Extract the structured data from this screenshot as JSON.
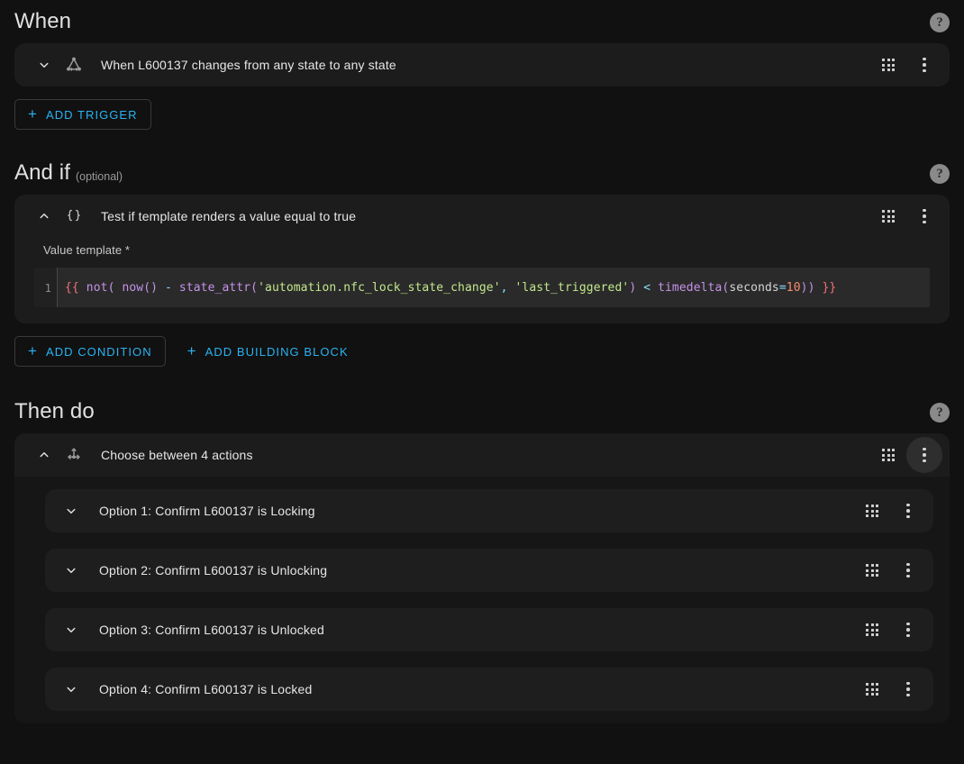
{
  "sections": {
    "when": {
      "title": "When",
      "help_label": "?",
      "trigger": {
        "title": "When L600137 changes from any state to any state",
        "icon": "state-trigger-icon"
      },
      "add_button": "ADD TRIGGER"
    },
    "and_if": {
      "title": "And if",
      "optional": "(optional)",
      "help_label": "?",
      "condition": {
        "title": "Test if template renders a value equal to true",
        "icon": "code-braces-icon",
        "field_label": "Value template *",
        "line_number": "1",
        "template": "{{ not( now() - state_attr('automation.nfc_lock_state_change', 'last_triggered') < timedelta(seconds=10)) }}",
        "template_tokens": [
          {
            "t": "{{",
            "c": "t-brace"
          },
          {
            "t": " ",
            "c": "t-plain"
          },
          {
            "t": "not(",
            "c": "t-fn"
          },
          {
            "t": " ",
            "c": "t-plain"
          },
          {
            "t": "now()",
            "c": "t-fn"
          },
          {
            "t": " ",
            "c": "t-plain"
          },
          {
            "t": "-",
            "c": "t-op"
          },
          {
            "t": " ",
            "c": "t-plain"
          },
          {
            "t": "state_attr(",
            "c": "t-fn"
          },
          {
            "t": "'automation.nfc_lock_state_change'",
            "c": "t-str"
          },
          {
            "t": ",",
            "c": "t-punc"
          },
          {
            "t": " ",
            "c": "t-plain"
          },
          {
            "t": "'last_triggered'",
            "c": "t-str"
          },
          {
            "t": ")",
            "c": "t-fn"
          },
          {
            "t": " ",
            "c": "t-plain"
          },
          {
            "t": "<",
            "c": "t-op"
          },
          {
            "t": " ",
            "c": "t-plain"
          },
          {
            "t": "timedelta(",
            "c": "t-fn"
          },
          {
            "t": "seconds",
            "c": "t-plain"
          },
          {
            "t": "=",
            "c": "t-op"
          },
          {
            "t": "10",
            "c": "t-num"
          },
          {
            "t": "))",
            "c": "t-fn"
          },
          {
            "t": " ",
            "c": "t-plain"
          },
          {
            "t": "}}",
            "c": "t-brace"
          }
        ]
      },
      "add_condition_button": "ADD CONDITION",
      "add_building_block_button": "ADD BUILDING BLOCK"
    },
    "then_do": {
      "title": "Then do",
      "help_label": "?",
      "choose": {
        "title": "Choose between 4 actions",
        "icon": "call-split-icon",
        "options": [
          {
            "title": "Option 1: Confirm L600137 is Locking"
          },
          {
            "title": "Option 2: Confirm L600137 is Unlocking"
          },
          {
            "title": "Option 3: Confirm L600137 is Unlocked"
          },
          {
            "title": "Option 4: Confirm L600137 is Locked"
          }
        ]
      }
    }
  },
  "colors": {
    "page_bg": "#111111",
    "card_bg": "#1c1c1c",
    "accent": "#29b3f3",
    "text": "#e1e1e1",
    "muted": "#9b9b9b"
  }
}
